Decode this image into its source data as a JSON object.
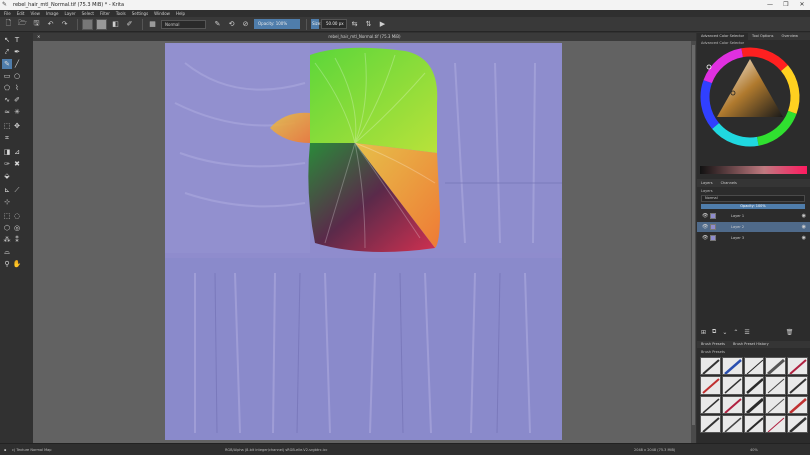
{
  "window": {
    "title": "rebel_hair_mtl_Normal.tif (75.3 MiB) * - Krita",
    "controls": [
      "—",
      "❒",
      "✕"
    ]
  },
  "menu": [
    "File",
    "Edit",
    "View",
    "Image",
    "Layer",
    "Select",
    "Filter",
    "Tools",
    "Settings",
    "Window",
    "Help"
  ],
  "toolbar": {
    "blend_mode": "Normal",
    "opacity_label": "Opacity: 100%",
    "size_label": "Size:",
    "size_value": "50.00 px"
  },
  "document": {
    "tab_title": "rebel_hair_mtl_Normal.tif (75.3 MiB)",
    "close_glyph": "✕"
  },
  "docker": {
    "tabs": [
      "Advanced Color Selector",
      "Tool Options",
      "Overview"
    ],
    "selector_title": "Advanced Color Selector",
    "layers_tabs": [
      "Layers",
      "Channels"
    ],
    "layers_header": "Layers",
    "blend": "Normal",
    "opacity": "Opacity: 100%",
    "layers": [
      {
        "name": "Layer 1",
        "active": false
      },
      {
        "name": "Layer 2",
        "active": true
      },
      {
        "name": "Layer 3",
        "active": false
      }
    ],
    "preset_tabs": [
      "Brush Presets",
      "Brush Preset History"
    ],
    "preset_header": "Brush Presets"
  },
  "status": {
    "left": "c) Texture Normal Map",
    "center": "RGB/Alpha (8-bit integer/channel)  sRGB-elle-V2-srgbtrc.icc",
    "right": "2048 x 2048 (75.3 MiB)",
    "zoom": "40%"
  },
  "colors": {
    "accent": "#4f7dab",
    "canvas_bg": "#626262",
    "normal_map": "#8f8ccd"
  }
}
